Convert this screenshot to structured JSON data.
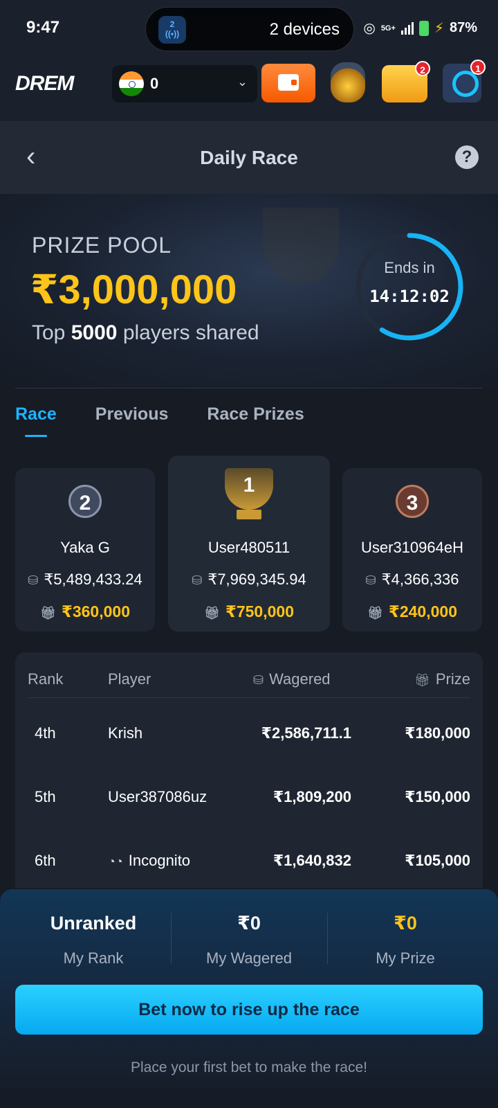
{
  "status_bar": {
    "time": "9:47",
    "island_app": "2",
    "island_text": "2 devices",
    "battery": "87%",
    "network": "5G+"
  },
  "header": {
    "logo": "DREM",
    "balance": "0",
    "jar_badge": "",
    "chest_badge": "2",
    "avatar_badge": "1"
  },
  "title_bar": {
    "back": "‹",
    "title": "Daily Race",
    "help": "?"
  },
  "hero": {
    "prize_label": "PRIZE POOL",
    "prize_amount": "₹3,000,000",
    "sub_prefix": "Top",
    "sub_count": "5000",
    "sub_suffix": "players shared",
    "ends_label": "Ends in",
    "countdown": "14:12:02",
    "timer_progress": 0.59
  },
  "tabs": [
    {
      "label": "Race",
      "active": true
    },
    {
      "label": "Previous",
      "active": false
    },
    {
      "label": "Race Prizes",
      "active": false
    }
  ],
  "podium": {
    "first": {
      "rank": "1",
      "name": "User480511",
      "wagered": "₹7,969,345.94",
      "prize": "₹750,000"
    },
    "second": {
      "rank": "2",
      "name": "Yaka G",
      "wagered": "₹5,489,433.24",
      "prize": "₹360,000"
    },
    "third": {
      "rank": "3",
      "name": "User310964eH",
      "wagered": "₹4,366,336",
      "prize": "₹240,000"
    }
  },
  "table": {
    "headers": {
      "rank": "Rank",
      "player": "Player",
      "wagered": "Wagered",
      "prize": "Prize"
    },
    "rows": [
      {
        "rank": "4th",
        "player": "Krish",
        "wagered": "₹2,586,711.1",
        "prize": "₹180,000"
      },
      {
        "rank": "5th",
        "player": "User387086uz",
        "wagered": "₹1,809,200",
        "prize": "₹150,000"
      },
      {
        "rank": "6th",
        "player": "Incognito",
        "wagered": "₹1,640,832",
        "prize": "₹105,000"
      }
    ]
  },
  "my_stats": {
    "rank_value": "Unranked",
    "rank_label": "My Rank",
    "wagered_value": "₹0",
    "wagered_label": "My Wagered",
    "prize_value": "₹0",
    "prize_label": "My Prize"
  },
  "cta": {
    "label": "Bet now to rise up the race",
    "hint": "Place your first bet to make the race!"
  },
  "colors": {
    "accent": "#1fb4ff",
    "gold": "#ffc41a",
    "background": "#161b24"
  }
}
